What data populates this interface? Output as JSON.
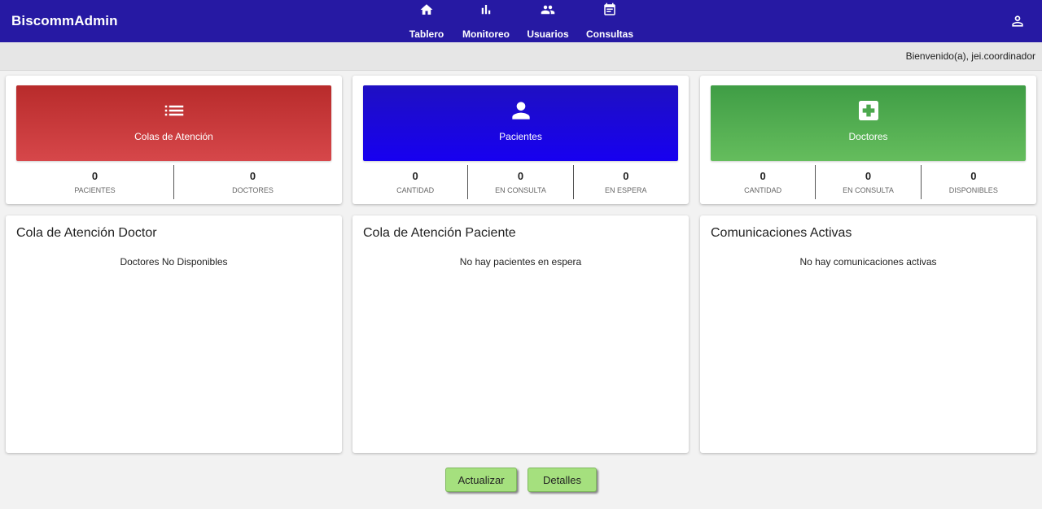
{
  "app": {
    "brand": "BiscommAdmin"
  },
  "nav": [
    {
      "label": "Tablero",
      "icon": "home-icon"
    },
    {
      "label": "Monitoreo",
      "icon": "bar-chart-icon"
    },
    {
      "label": "Usuarios",
      "icon": "people-icon"
    },
    {
      "label": "Consultas",
      "icon": "calendar-icon"
    }
  ],
  "header": {
    "welcome": "Bienvenido(a), jei.coordinador",
    "user_icon": "account-icon"
  },
  "cards": {
    "colas": {
      "title": "Colas de Atención",
      "icon": "list-icon",
      "color": "#c93636",
      "stats": [
        {
          "value": "0",
          "label": "PACIENTES"
        },
        {
          "value": "0",
          "label": "DOCTORES"
        }
      ]
    },
    "pacientes": {
      "title": "Pacientes",
      "icon": "person-icon",
      "color": "#1a07e0",
      "stats": [
        {
          "value": "0",
          "label": "CANTIDAD"
        },
        {
          "value": "0",
          "label": "EN CONSULTA"
        },
        {
          "value": "0",
          "label": "EN ESPERA"
        }
      ]
    },
    "doctores": {
      "title": "Doctores",
      "icon": "medical-cross-icon",
      "color": "#52ad52",
      "stats": [
        {
          "value": "0",
          "label": "CANTIDAD"
        },
        {
          "value": "0",
          "label": "EN CONSULTA"
        },
        {
          "value": "0",
          "label": "DISPONIBLES"
        }
      ]
    }
  },
  "panels": [
    {
      "title": "Cola de Atención Doctor",
      "message": "Doctores No Disponibles"
    },
    {
      "title": "Cola de Atención Paciente",
      "message": "No hay pacientes en espera"
    },
    {
      "title": "Comunicaciones Activas",
      "message": "No hay comunicaciones activas"
    }
  ],
  "actions": {
    "refresh": "Actualizar",
    "details": "Detalles"
  },
  "colors": {
    "topbar": "#2619a3",
    "button": "#a5e07e"
  }
}
